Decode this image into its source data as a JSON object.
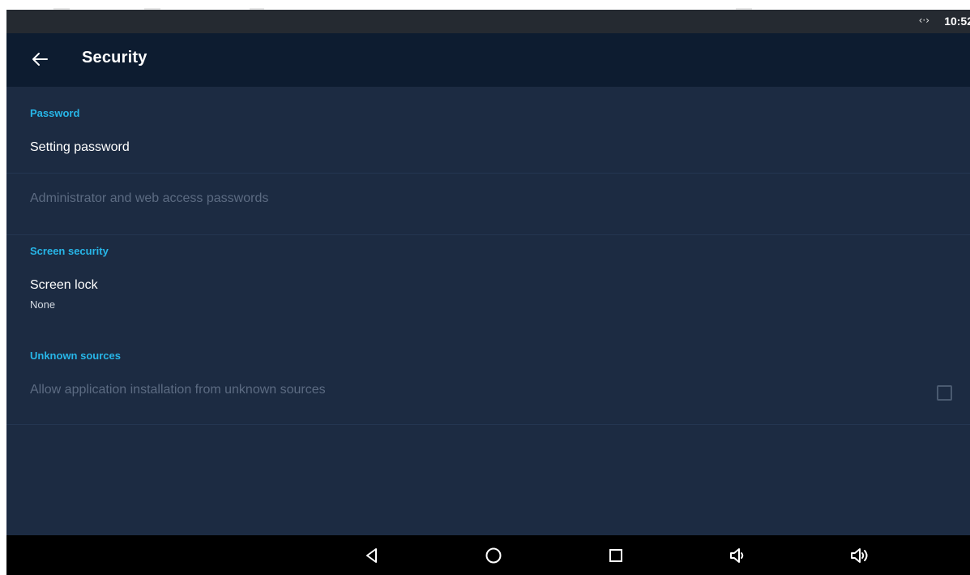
{
  "status_bar": {
    "network_icon": "network-arrows-icon",
    "network_glyph": "‹·›",
    "time": "10:52"
  },
  "app_bar": {
    "back_icon": "back-arrow-icon",
    "title": "Security"
  },
  "sections": [
    {
      "header": "Password",
      "items": [
        {
          "title": "Setting password",
          "enabled": true
        },
        {
          "title": "Administrator and web access passwords",
          "enabled": false
        }
      ]
    },
    {
      "header": "Screen security",
      "items": [
        {
          "title": "Screen lock",
          "summary": "None",
          "enabled": true
        }
      ]
    },
    {
      "header": "Unknown sources",
      "items": [
        {
          "title": "Allow application installation from unknown sources",
          "enabled": false,
          "checked": false
        }
      ]
    }
  ],
  "nav_bar": {
    "buttons": [
      "back-triangle-icon",
      "home-circle-icon",
      "recents-square-icon",
      "volume-down-icon",
      "volume-up-icon"
    ]
  },
  "colors": {
    "background": "#1c2b42",
    "app_bar": "#0d1c30",
    "accent": "#27b6e8",
    "status_bar": "#252a31",
    "nav_bar": "#000000",
    "disabled_text": "#5c6b82"
  }
}
